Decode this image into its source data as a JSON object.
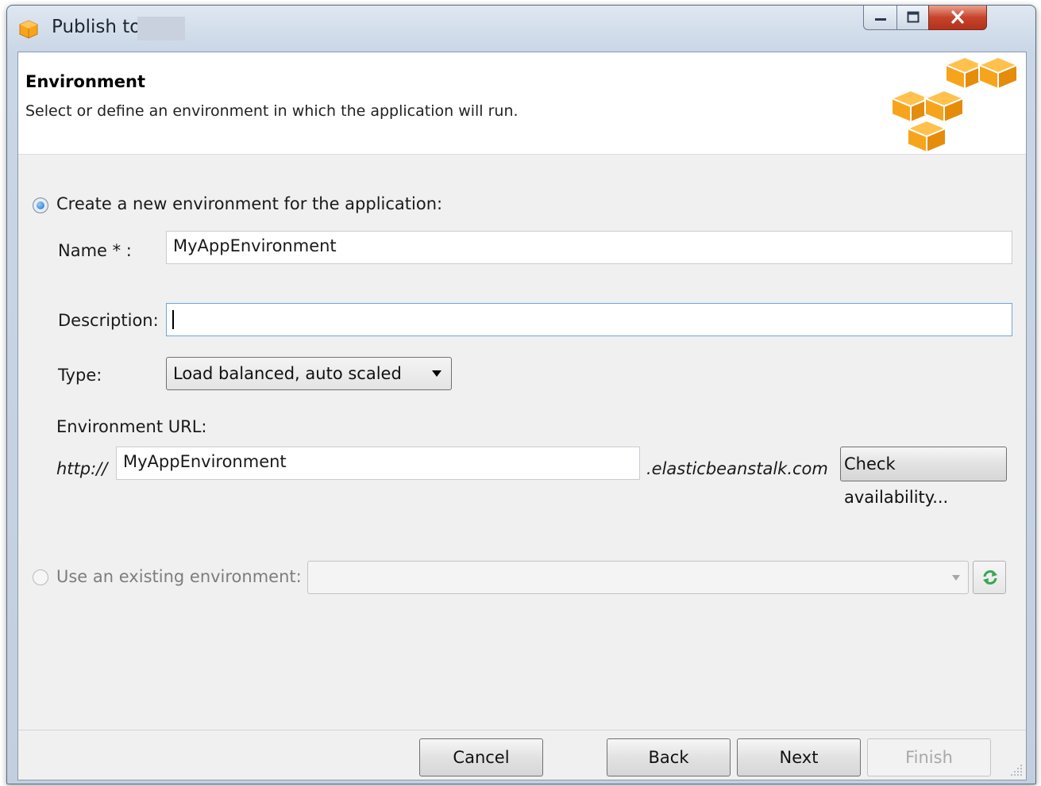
{
  "window": {
    "title": "Publish to"
  },
  "header": {
    "title": "Environment",
    "subtitle": "Select or define an environment in which the application will run."
  },
  "new_env": {
    "radio_label": "Create a new environment for the application:",
    "selected": true,
    "name_label": "Name * :",
    "name_value": "MyAppEnvironment",
    "description_label": "Description:",
    "description_value": "",
    "type_label": "Type:",
    "type_value": "Load balanced, auto scaled",
    "url_label": "Environment URL:",
    "url_prefix": "http://",
    "url_value": "MyAppEnvironment",
    "url_suffix": ".elasticbeanstalk.com",
    "check_button": "Check availability..."
  },
  "existing_env": {
    "radio_label": "Use an existing environment:",
    "selected": false,
    "selected_value": ""
  },
  "footer": {
    "cancel": "Cancel",
    "back": "Back",
    "next": "Next",
    "finish": "Finish"
  },
  "colors": {
    "accent_orange": "#f7a41d",
    "radio_blue": "#1d6fc6",
    "refresh_green": "#3aa655"
  },
  "icons": {
    "app": "aws-box-icon",
    "logo": "aws-cubes-logo",
    "refresh": "refresh-icon"
  }
}
